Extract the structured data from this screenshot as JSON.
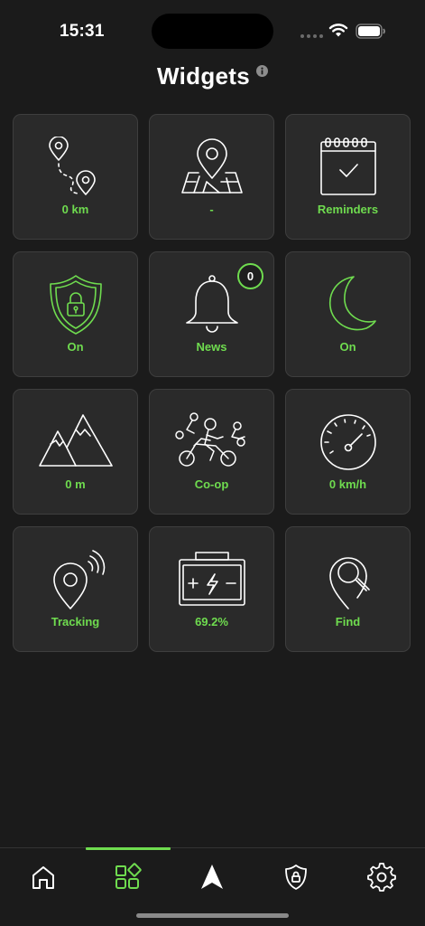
{
  "status_bar": {
    "time": "15:31"
  },
  "header": {
    "title": "Widgets"
  },
  "widgets": [
    {
      "label": "0 km",
      "icon": "route-icon"
    },
    {
      "label": "-",
      "icon": "map-pin-icon"
    },
    {
      "label": "Reminders",
      "icon": "calendar-check-icon"
    },
    {
      "label": "On",
      "icon": "shield-lock-icon"
    },
    {
      "label": "News",
      "icon": "bell-icon",
      "badge": "0"
    },
    {
      "label": "On",
      "icon": "moon-icon"
    },
    {
      "label": "0 m",
      "icon": "mountains-icon"
    },
    {
      "label": "Co-op",
      "icon": "motorcycle-riders-icon"
    },
    {
      "label": "0 km/h",
      "icon": "speedometer-icon"
    },
    {
      "label": "Tracking",
      "icon": "location-signal-icon"
    },
    {
      "label": "69.2%",
      "icon": "battery-charge-icon"
    },
    {
      "label": "Find",
      "icon": "pin-search-icon"
    }
  ],
  "tab_bar": {
    "items": [
      {
        "icon": "home-icon"
      },
      {
        "icon": "widgets-icon",
        "active": true
      },
      {
        "icon": "navigation-arrow-icon"
      },
      {
        "icon": "shield-lock-icon"
      },
      {
        "icon": "gear-icon"
      }
    ]
  },
  "colors": {
    "background": "#1b1b1b",
    "tile": "#2a2a2a",
    "accent": "#6fdc4f",
    "text": "#ffffff"
  }
}
